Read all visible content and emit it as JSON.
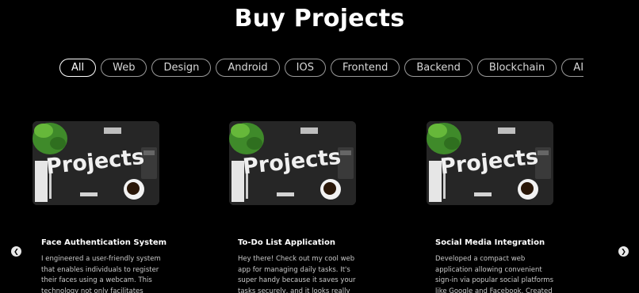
{
  "page": {
    "title": "Buy Projects"
  },
  "filters": [
    {
      "label": "All",
      "active": true
    },
    {
      "label": "Web",
      "active": false
    },
    {
      "label": "Design",
      "active": false
    },
    {
      "label": "Android",
      "active": false
    },
    {
      "label": "IOS",
      "active": false
    },
    {
      "label": "Frontend",
      "active": false
    },
    {
      "label": "Backend",
      "active": false
    },
    {
      "label": "Blockchain",
      "active": false
    },
    {
      "label": "AI",
      "active": false
    }
  ],
  "projects": [
    {
      "image_text": "Projects",
      "title": "Face Authentication System",
      "description": "I engineered a user-friendly system that enables individuals to register their faces using a webcam. This technology not only facilitates"
    },
    {
      "image_text": "Projects",
      "title": "To-Do List Application",
      "description": "Hey there! Check out my cool web app for managing daily tasks. It's super handy because it saves your tasks securely, and it looks really"
    },
    {
      "image_text": "Projects",
      "title": "Social Media Integration",
      "description": "Developed a compact web application allowing convenient sign-in via popular social platforms like Google and Facebook. Created"
    }
  ],
  "navigation": {
    "prev_icon": "chevron-left-icon",
    "next_icon": "chevron-right-icon"
  },
  "colors": {
    "background": "#000000",
    "text": "#ffffff",
    "chip_border": "#9a9a9a"
  }
}
